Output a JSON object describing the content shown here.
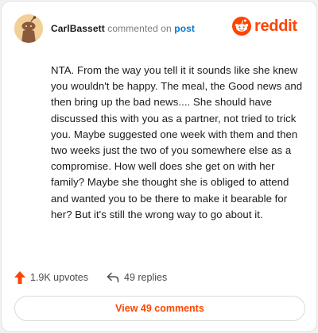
{
  "comment": {
    "username": "CarlBassett",
    "action_text": "commented on",
    "link_text": "post",
    "body": "NTA. From the way you tell it it sounds like she knew you wouldn't be happy. The meal, the Good news and then bring up the bad news.... She should have discussed this with you as a partner, not tried to trick you. Maybe suggested one week with them and then two weeks just the two of you somewhere else as a compromise. How well does she get on with her family? Maybe she thought she is obliged to attend and wanted you to be there to make it bearable for her? But it's still the wrong way to go about it."
  },
  "brand": {
    "wordmark": "reddit",
    "color": "#ff4500"
  },
  "stats": {
    "upvotes": "1.9K upvotes",
    "replies": "49 replies"
  },
  "actions": {
    "view_comments": "View 49 comments"
  },
  "icons": {
    "avatar": "snoo-avatar-icon",
    "logo": "reddit-alien-icon",
    "upvote": "upvote-arrow-icon",
    "reply": "reply-arrow-icon"
  },
  "colors": {
    "link": "#0079d3",
    "accent": "#ff4500",
    "text": "#1a1a1b",
    "muted": "#7c7c7c"
  }
}
